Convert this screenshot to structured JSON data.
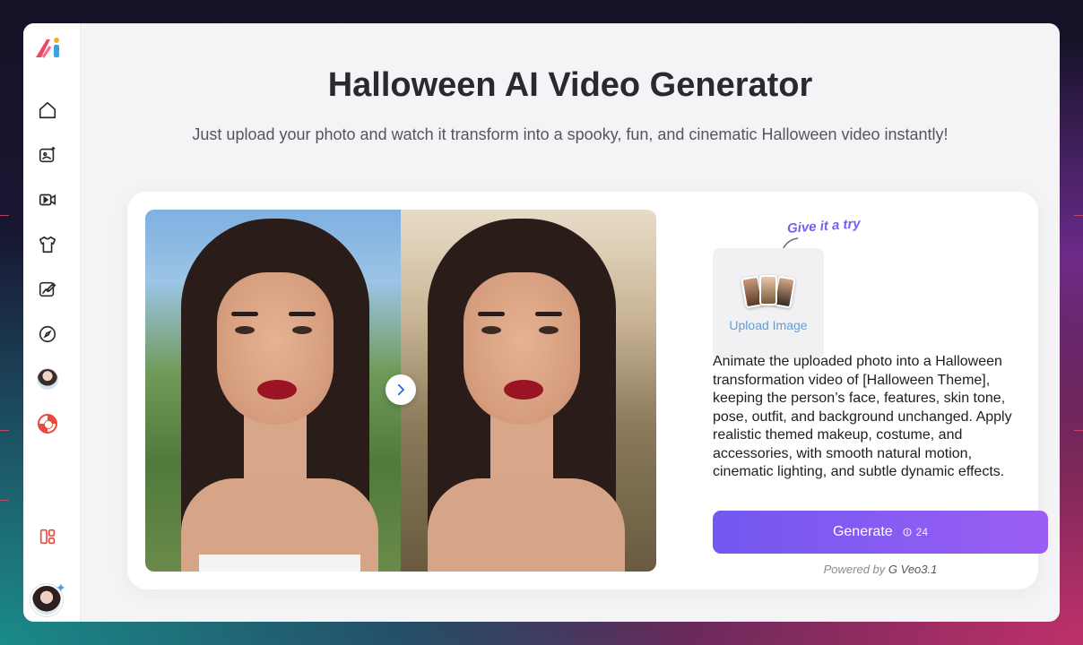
{
  "header": {
    "title": "Halloween AI Video Generator",
    "subtitle": "Just upload your photo and watch it transform into a spooky, fun, and cinematic Halloween video instantly!"
  },
  "sidebar": {
    "items": [
      {
        "name": "home-icon"
      },
      {
        "name": "image-ai-icon"
      },
      {
        "name": "video-icon"
      },
      {
        "name": "shirt-icon"
      },
      {
        "name": "photo-edit-icon"
      },
      {
        "name": "compass-icon"
      },
      {
        "name": "avatar-app-icon"
      },
      {
        "name": "lifebuoy-icon"
      }
    ],
    "bottom": [
      {
        "name": "layout-icon"
      }
    ]
  },
  "tool": {
    "hint": "Give it a try",
    "upload_label": "Upload Image",
    "prompt": "Animate the uploaded photo into a Halloween transformation video of [Halloween Theme], keeping the person’s face, features, skin tone, pose, outfit, and background unchanged. Apply realistic themed makeup, costume, and accessories, with smooth natural motion, cinematic lighting, and subtle dynamic effects.",
    "generate_label": "Generate",
    "credits": "24",
    "powered_prefix": "Powered by",
    "powered_model": "Veo3.1"
  },
  "colors": {
    "accent": "#7b5cf0",
    "upload_text": "#5aa0e0",
    "logo_red": "#e84a6a",
    "logo_blue": "#3aa0e8"
  }
}
